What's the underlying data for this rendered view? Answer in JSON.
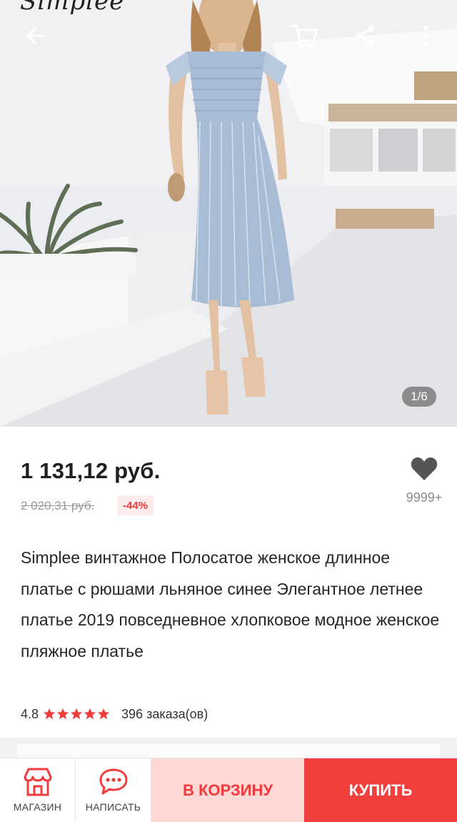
{
  "header": {
    "brand": "Simplee",
    "photo_counter": "1/6"
  },
  "icons": {
    "back": "arrow-left",
    "cart": "cart",
    "share": "share",
    "more": "more-vertical",
    "favorite": "heart",
    "rating_star": "star",
    "store": "storefront",
    "message": "chat-bubble"
  },
  "price": {
    "current": "1 131,12 руб.",
    "old": "2 020,31 руб.",
    "discount": "-44%",
    "favorites_count": "9999+"
  },
  "product": {
    "title": "Simplee винтажное Полосатое женское длинное платье с рюшами льняное синее Элегантное летнее платье 2019 повседневное хлопковое модное женское пляжное платье",
    "rating": "4.8",
    "stars": 5,
    "orders": "396 заказа(ов)"
  },
  "bottom_bar": {
    "store_label": "МАГАЗИН",
    "message_label": "НАПИСАТЬ",
    "add_to_cart_label": "В КОРЗИНУ",
    "buy_label": "КУПИТЬ"
  },
  "colors": {
    "accent": "#f33e3e",
    "accent_light": "#fdd8d4",
    "star": "#f23b3b",
    "dress": "#a9bcd6"
  }
}
